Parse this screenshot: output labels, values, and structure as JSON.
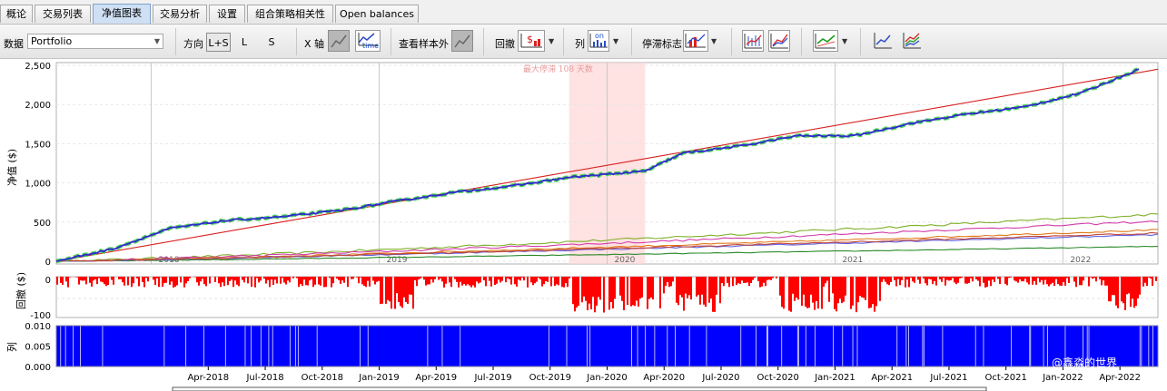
{
  "tabs": [
    {
      "label": "概论",
      "active": false
    },
    {
      "label": "交易列表",
      "active": false
    },
    {
      "label": "净值图表",
      "active": true
    },
    {
      "label": "交易分析",
      "active": false
    },
    {
      "label": "设置",
      "active": false
    },
    {
      "label": "组合策略相关性",
      "active": false
    },
    {
      "label": "Open balances",
      "active": false
    }
  ],
  "toolbar": {
    "data_label": "数据",
    "data_value": "Portfolio",
    "direction_label": "方向",
    "direction_options": [
      "L+S",
      "L",
      "S"
    ],
    "direction_selected": "L+S",
    "xaxis_label": "X 轴",
    "out_of_sample_label": "查看样本外",
    "drawdown_label": "回撤",
    "columns_label": "列",
    "stagnation_label": "停滞标志",
    "on_text": "on",
    "time_text": "time"
  },
  "colors": {
    "equity": "#2f2fc8",
    "equity_highlight": "#3ad63a",
    "trend": "#d82020",
    "drawdown": "#ff0000",
    "columns": "#0000ff",
    "stagnation_band": "#ffd6d6",
    "minor_series": [
      "#7fb02a",
      "#d23aa8",
      "#e07a1a",
      "#2a8a2a",
      "#6060e0",
      "#c0463a"
    ]
  },
  "annotation": "最大停滞 108 天数",
  "chart_data": {
    "type": "line",
    "x_tick_labels_main": [
      "2018",
      "2019",
      "2020",
      "2021",
      "2022"
    ],
    "x_tick_labels_bottom": [
      "Apr-2018",
      "Jul-2018",
      "Oct-2018",
      "Jan-2019",
      "Apr-2019",
      "Jul-2019",
      "Oct-2019",
      "Jan-2020",
      "Apr-2020",
      "Jul-2020",
      "Oct-2020",
      "Jan-2021",
      "Apr-2021",
      "Jul-2021",
      "Oct-2021",
      "Jan-2022",
      "Apr-2022"
    ],
    "x_range": [
      "2017-08",
      "2022-06"
    ],
    "equity_panel": {
      "ylabel": "净值 ($)",
      "ylim": [
        0,
        2500
      ],
      "y_ticks": [
        "0",
        "500",
        "1,000",
        "1,500",
        "2,000",
        "2,500"
      ],
      "portfolio_equity": {
        "x": [
          "2017-08",
          "2017-11",
          "2018-02",
          "2018-05",
          "2018-08",
          "2018-11",
          "2019-02",
          "2019-05",
          "2019-08",
          "2019-11",
          "2020-01",
          "2020-03",
          "2020-05",
          "2020-08",
          "2020-11",
          "2021-02",
          "2021-05",
          "2021-08",
          "2021-11",
          "2022-02",
          "2022-05"
        ],
        "y": [
          0,
          160,
          420,
          520,
          570,
          650,
          770,
          880,
          960,
          1070,
          1110,
          1150,
          1380,
          1470,
          1600,
          1600,
          1760,
          1880,
          1970,
          2150,
          2450
        ]
      },
      "trend_line": {
        "x": [
          "2017-08",
          "2022-06"
        ],
        "y": [
          0,
          2450
        ]
      },
      "minor_series": [
        {
          "y_end": 600
        },
        {
          "y_end": 510
        },
        {
          "y_end": 400
        },
        {
          "y_end": 190
        },
        {
          "y_end": 340
        },
        {
          "y_end": 360
        }
      ],
      "max_stagnation": {
        "start": "2019-11",
        "end": "2020-03",
        "days": 108
      }
    },
    "drawdown_panel": {
      "ylabel": "回撤 ($)",
      "y_ticks": [
        "0",
        "-100"
      ],
      "ylim": [
        -100,
        0
      ]
    },
    "columns_panel": {
      "ylabel": "列",
      "y_ticks": [
        "0.010",
        "0.005",
        "0.000"
      ],
      "ylim": [
        0,
        0.01
      ]
    }
  },
  "watermark": "@鑫淼的世界"
}
